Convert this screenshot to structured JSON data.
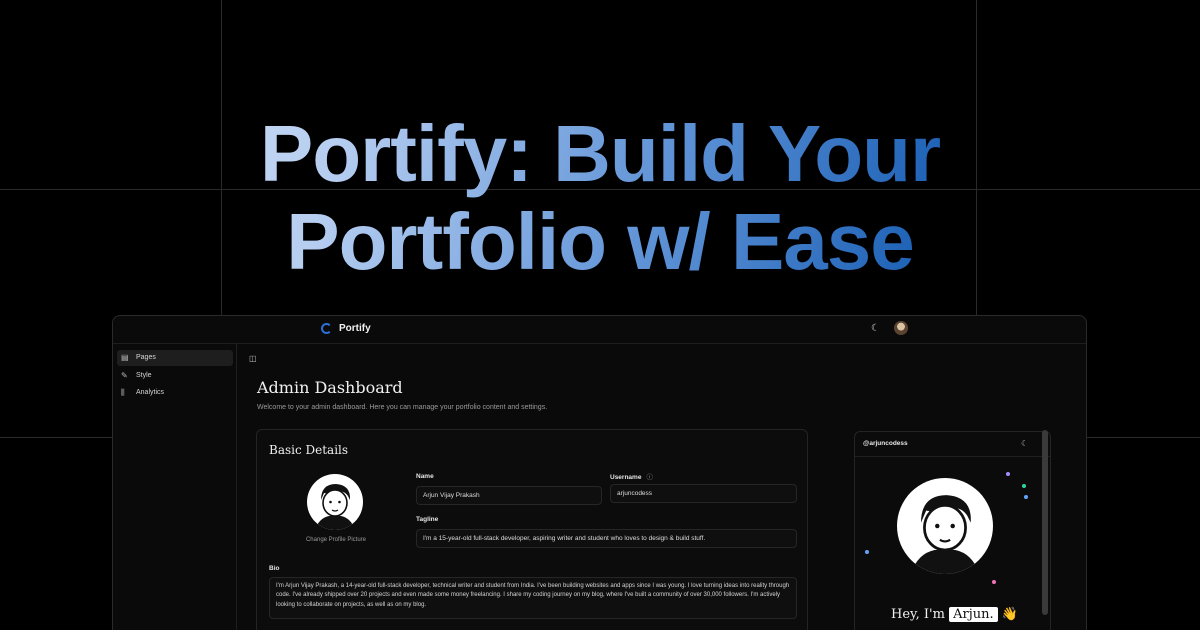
{
  "hero": {
    "line1": "Portify: Build Your",
    "line2": "Portfolio w/ Ease"
  },
  "app": {
    "brand": "Portify",
    "theme_icon": "moon-icon",
    "sidebar": {
      "items": [
        {
          "label": "Pages",
          "icon": "file-icon",
          "active": true
        },
        {
          "label": "Style",
          "icon": "palette-icon",
          "active": false
        },
        {
          "label": "Analytics",
          "icon": "bar-chart-icon",
          "active": false
        }
      ]
    },
    "main": {
      "title": "Admin Dashboard",
      "subtitle": "Welcome to your admin dashboard. Here you can manage your portfolio content and settings.",
      "basic_details": {
        "title": "Basic Details",
        "change_picture": "Change Profile Picture",
        "name_label": "Name",
        "name_value": "Arjun Vijay Prakash",
        "username_label": "Username",
        "username_value": "arjuncodess",
        "tagline_label": "Tagline",
        "tagline_value": "I'm a 15-year-old full-stack developer, aspiring writer and student who loves to design & build stuff.",
        "bio_label": "Bio",
        "bio_value": "I'm Arjun Vijay Prakash, a 14-year-old full-stack developer, technical writer and student from India. I've been building websites and apps since I was young. I love turning ideas into reality through code. I've already shipped over 20 projects and even made some money freelancing. I share my coding journey on my blog, where I've built a community of over 30,000 followers. I'm actively looking to collaborate on projects, as well as on my blog."
      }
    },
    "preview": {
      "handle": "@arjuncodess",
      "greeting": "Hey, I'm",
      "name": "Arjun.",
      "wave": "👋",
      "dot_colors": [
        "#a78bfa",
        "#34d399",
        "#60a5fa",
        "#f472b6",
        "#60a5fa"
      ]
    }
  },
  "colors": {
    "accent": "#2d6fd6",
    "background": "#000000",
    "panel": "#0a0a0a"
  }
}
